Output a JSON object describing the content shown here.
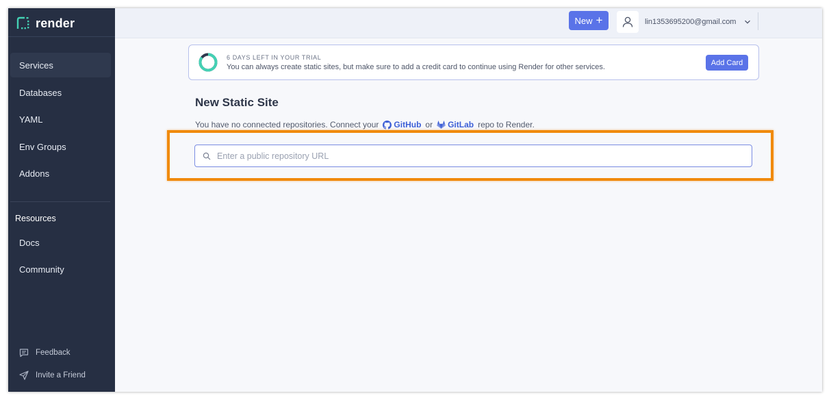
{
  "brand": {
    "name": "render",
    "accent": "#44d1b4"
  },
  "sidebar": {
    "items": [
      {
        "label": "Services",
        "active": true
      },
      {
        "label": "Databases"
      },
      {
        "label": "YAML"
      },
      {
        "label": "Env Groups"
      },
      {
        "label": "Addons"
      }
    ],
    "resources_heading": "Resources",
    "resource_items": [
      {
        "label": "Docs"
      },
      {
        "label": "Community"
      }
    ],
    "footer": {
      "feedback": "Feedback",
      "invite": "Invite a Friend"
    }
  },
  "header": {
    "new_label": "New",
    "new_icon": "+",
    "email": "lin1353695200@gmail.com"
  },
  "trial": {
    "title": "6 DAYS LEFT IN YOUR TRIAL",
    "description": "You can always create static sites, but make sure to add a credit card to continue using Render for other services.",
    "button": "Add Card",
    "progress": 0.85
  },
  "main": {
    "title": "New Static Site",
    "connect_prefix": "You have no connected repositories. Connect your",
    "github": "GitHub",
    "or": "or",
    "gitlab": "GitLab",
    "connect_suffix": "repo to Render.",
    "search_placeholder": "Enter a public repository URL"
  },
  "colors": {
    "sidebar_bg": "#262f43",
    "primary": "#5a73e8",
    "highlight": "#f08a0c"
  }
}
